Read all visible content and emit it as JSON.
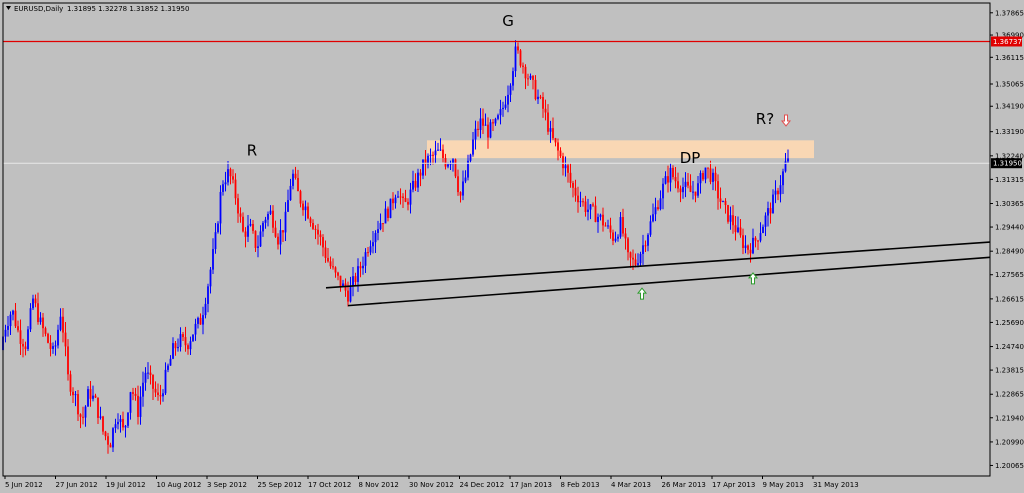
{
  "chart_data": {
    "type": "candlestick",
    "title": "EURUSD,Daily",
    "ohlc_label": "1.31895 1.32278 1.31852 1.31950",
    "ylim": [
      1.1965,
      1.3825
    ],
    "y_ticks": [
      "1.37865",
      "1.36990",
      "1.36115",
      "1.35065",
      "1.34190",
      "1.33190",
      "1.32240",
      "1.31315",
      "1.30365",
      "1.29440",
      "1.28490",
      "1.27565",
      "1.26615",
      "1.25690",
      "1.24740",
      "1.23815",
      "1.22865",
      "1.21940",
      "1.20990",
      "1.20065"
    ],
    "x_ticks": [
      "5 Jun 2012",
      "27 Jun 2012",
      "19 Jul 2012",
      "10 Aug 2012",
      "3 Sep 2012",
      "25 Sep 2012",
      "17 Oct 2012",
      "8 Nov 2012",
      "30 Nov 2012",
      "24 Dec 2012",
      "17 Jan 2013",
      "8 Feb 2013",
      "4 Mar 2013",
      "26 Mar 2013",
      "17 Apr 2013",
      "9 May 2013",
      "31 May 2013"
    ],
    "bull_color": "#0000ff",
    "bear_color": "#ff0000",
    "grid": false,
    "price_path": [
      [
        0,
        1.246
      ],
      [
        5,
        1.255
      ],
      [
        12,
        1.262
      ],
      [
        19,
        1.252
      ],
      [
        26,
        1.248
      ],
      [
        33,
        1.266
      ],
      [
        40,
        1.257
      ],
      [
        47,
        1.25
      ],
      [
        54,
        1.244
      ],
      [
        61,
        1.262
      ],
      [
        68,
        1.235
      ],
      [
        75,
        1.228
      ],
      [
        82,
        1.218
      ],
      [
        89,
        1.23
      ],
      [
        96,
        1.225
      ],
      [
        103,
        1.214
      ],
      [
        110,
        1.209
      ],
      [
        117,
        1.222
      ],
      [
        124,
        1.213
      ],
      [
        131,
        1.232
      ],
      [
        138,
        1.222
      ],
      [
        145,
        1.238
      ],
      [
        152,
        1.232
      ],
      [
        159,
        1.226
      ],
      [
        166,
        1.236
      ],
      [
        173,
        1.246
      ],
      [
        180,
        1.25
      ],
      [
        187,
        1.248
      ],
      [
        194,
        1.254
      ],
      [
        201,
        1.258
      ],
      [
        208,
        1.272
      ],
      [
        215,
        1.288
      ],
      [
        222,
        1.312
      ],
      [
        229,
        1.316
      ],
      [
        236,
        1.306
      ],
      [
        243,
        1.292
      ],
      [
        250,
        1.294
      ],
      [
        257,
        1.286
      ],
      [
        264,
        1.298
      ],
      [
        271,
        1.3
      ],
      [
        278,
        1.29
      ],
      [
        285,
        1.296
      ],
      [
        292,
        1.316
      ],
      [
        299,
        1.306
      ],
      [
        306,
        1.302
      ],
      [
        313,
        1.296
      ],
      [
        320,
        1.29
      ],
      [
        327,
        1.282
      ],
      [
        334,
        1.276
      ],
      [
        341,
        1.272
      ],
      [
        348,
        1.268
      ],
      [
        355,
        1.274
      ],
      [
        362,
        1.28
      ],
      [
        369,
        1.288
      ],
      [
        376,
        1.294
      ],
      [
        383,
        1.298
      ],
      [
        390,
        1.302
      ],
      [
        397,
        1.31
      ],
      [
        404,
        1.302
      ],
      [
        411,
        1.308
      ],
      [
        418,
        1.314
      ],
      [
        425,
        1.32
      ],
      [
        432,
        1.322
      ],
      [
        439,
        1.324
      ],
      [
        446,
        1.32
      ],
      [
        453,
        1.322
      ],
      [
        460,
        1.306
      ],
      [
        467,
        1.316
      ],
      [
        474,
        1.33
      ],
      [
        481,
        1.336
      ],
      [
        488,
        1.332
      ],
      [
        495,
        1.334
      ],
      [
        502,
        1.34
      ],
      [
        509,
        1.35
      ],
      [
        516,
        1.364
      ],
      [
        523,
        1.358
      ],
      [
        530,
        1.352
      ],
      [
        537,
        1.346
      ],
      [
        544,
        1.34
      ],
      [
        551,
        1.33
      ],
      [
        558,
        1.324
      ],
      [
        565,
        1.318
      ],
      [
        572,
        1.31
      ],
      [
        579,
        1.306
      ],
      [
        586,
        1.302
      ],
      [
        593,
        1.3
      ],
      [
        600,
        1.298
      ],
      [
        607,
        1.294
      ],
      [
        614,
        1.29
      ],
      [
        621,
        1.296
      ],
      [
        628,
        1.282
      ],
      [
        635,
        1.28
      ],
      [
        642,
        1.286
      ],
      [
        649,
        1.294
      ],
      [
        656,
        1.302
      ],
      [
        663,
        1.31
      ],
      [
        670,
        1.316
      ],
      [
        677,
        1.312
      ],
      [
        684,
        1.31
      ],
      [
        691,
        1.308
      ],
      [
        698,
        1.31
      ],
      [
        705,
        1.318
      ],
      [
        712,
        1.314
      ],
      [
        719,
        1.306
      ],
      [
        726,
        1.3
      ],
      [
        733,
        1.296
      ],
      [
        740,
        1.29
      ],
      [
        747,
        1.286
      ],
      [
        754,
        1.288
      ],
      [
        761,
        1.294
      ],
      [
        768,
        1.3
      ],
      [
        775,
        1.306
      ],
      [
        782,
        1.314
      ],
      [
        786,
        1.32
      ],
      [
        790,
        1.3195
      ]
    ],
    "resistance_level": "1.36737",
    "current_price": "1.31950",
    "zone": {
      "from": 1.3215,
      "to": 1.3285
    },
    "trend_lines": [
      {
        "from": [
          326,
          1.2705
        ],
        "to": [
          990,
          1.2885
        ]
      },
      {
        "from": [
          348,
          1.2635
        ],
        "to": [
          990,
          1.2825
        ]
      }
    ],
    "annotations": [
      {
        "text": "G",
        "x": 508,
        "y": 1.3735
      },
      {
        "text": "R",
        "x": 252,
        "y": 1.3225
      },
      {
        "text": "DP",
        "x": 690,
        "y": 1.3195
      },
      {
        "text": "R?",
        "x": 765,
        "y": 1.335
      }
    ],
    "arrows": [
      {
        "dir": "up",
        "x": 642,
        "y": 1.268,
        "color": "#2e9b2e"
      },
      {
        "dir": "up",
        "x": 753,
        "y": 1.274,
        "color": "#2e9b2e"
      },
      {
        "dir": "down",
        "x": 786,
        "y": 1.3365,
        "color": "#e05050"
      }
    ]
  }
}
